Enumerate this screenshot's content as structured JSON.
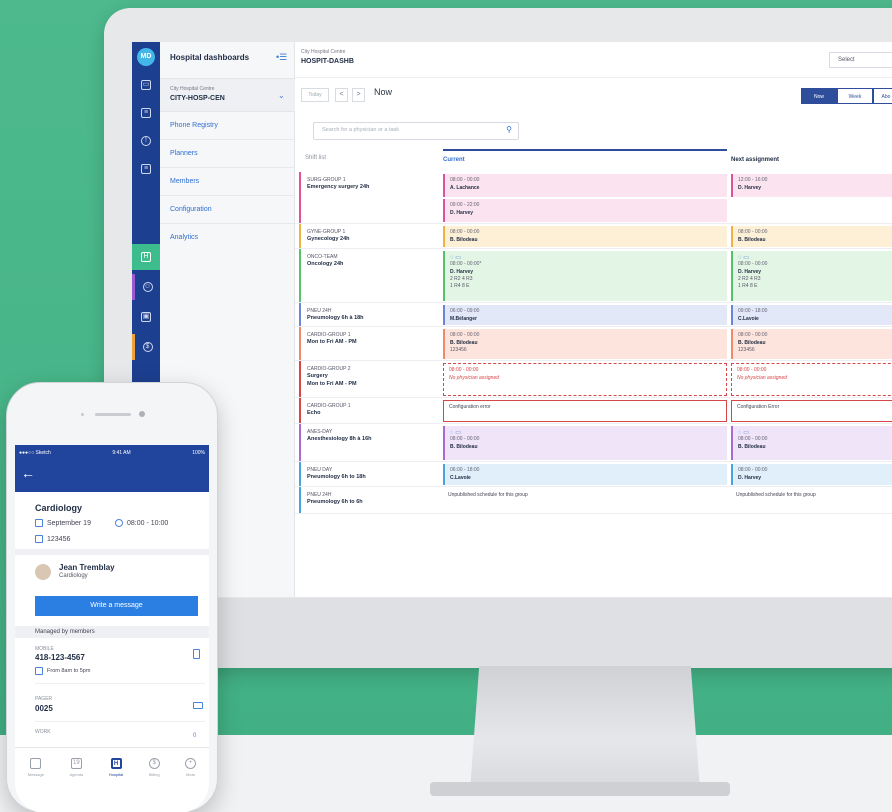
{
  "colors": {
    "brand": "#21459c",
    "accent": "#3dbd8e",
    "link": "#2f6fd0",
    "error": "#d84747",
    "background": "#4db98c"
  },
  "desktop": {
    "logo": "MD",
    "app_title": "Hospital dashboards",
    "org": {
      "name": "City Hospital Centre",
      "code": "CITY-HOSP-CEN"
    },
    "menu": [
      "Phone Registry",
      "Planners",
      "Members",
      "Configuration",
      "Analytics"
    ],
    "header": {
      "org_name": "City Hospital Centre",
      "dashboard_code": "HOSPIT-DASHB",
      "select_label": "Select"
    },
    "nav": {
      "today": "Today",
      "prev": "<",
      "next": ">",
      "title": "Now",
      "views": [
        "Now",
        "Week",
        "Abo"
      ]
    },
    "search": {
      "placeholder": "Search for a physician or a task"
    },
    "columns": {
      "shift": "Shift list",
      "current": "Current",
      "next": "Next assignment"
    },
    "rows": [
      {
        "group": "SURG-GROUP 1",
        "desc": "Emergency surgery 24h",
        "desc2": "",
        "color": "#e0529c",
        "current": [
          {
            "time": "08:00 - 00:00",
            "name": "A. Lachance",
            "extra": ""
          },
          {
            "time": "09:00 - 22:00",
            "name": "D. Harvey",
            "extra": ""
          }
        ],
        "next": {
          "time": "12:00 - 16:00",
          "name": "D. Harvey",
          "extra": ""
        }
      },
      {
        "group": "GYNE-GROUP 1",
        "desc": "Gynecology 24h",
        "desc2": "",
        "color": "#f2b23f",
        "current": [
          {
            "time": "08:00 - 00:00",
            "name": "B. Bilodeau",
            "extra": ""
          }
        ],
        "next": {
          "time": "08:00 - 00:00",
          "name": "B. Bilodeau",
          "extra": ""
        }
      },
      {
        "group": "ONCO-TEAM",
        "desc": "Oncology 24h",
        "desc2": "",
        "color": "#58c26a",
        "current": [
          {
            "time": "08:00 - 00:00*",
            "name": "D. Harvey",
            "extra": "2 R2  4 R3",
            "extra2": "1 R4  8 E"
          }
        ],
        "next": {
          "time": "08:00 - 00:00",
          "name": "D. Harvey",
          "extra": "2 R2  4 R3",
          "extra2": "1 R4  8 E"
        }
      },
      {
        "group": "PNEU 24H",
        "desc": "Pneumology 6h à 18h",
        "desc2": "",
        "color": "#6b86d6",
        "current": [
          {
            "time": "06:00 - 09:00",
            "name": "M.Bélanger",
            "extra": ""
          }
        ],
        "next": {
          "time": "09:00 - 18:00",
          "name": "C.Lavoie",
          "extra": ""
        }
      },
      {
        "group": "CARDIO-GROUP 1",
        "desc": "Mon to Fri  AM - PM",
        "desc2": "",
        "color": "#f08a6a",
        "current": [
          {
            "time": "08:00 - 00:00",
            "name": "B. Bilodeau",
            "extra": "123456"
          }
        ],
        "next": {
          "time": "08:00 - 00:00",
          "name": "B. Bilodeau",
          "extra": "123456"
        }
      },
      {
        "group": "CARDIO-GROUP 2",
        "desc": "Surgery",
        "desc2": "Mon to Fri  AM - PM",
        "color": "#d84747",
        "current": [
          {
            "time": "08:00 - 00:00",
            "name": "No physician assigned",
            "extra": ""
          }
        ],
        "next": {
          "time": "08:00 - 00:00",
          "name": "No physician assigned",
          "extra": ""
        }
      },
      {
        "group": "CARDIO-GROUP 1",
        "desc": "Echo",
        "desc2": "",
        "color": "#d84747",
        "current": [
          {
            "time": "",
            "name": "Configuration error",
            "extra": ""
          }
        ],
        "next": {
          "time": "",
          "name": "Configuration Error",
          "extra": ""
        }
      },
      {
        "group": "ANES-DAY",
        "desc": "Anesthesiology 8h à 16h",
        "desc2": "",
        "color": "#a86bd6",
        "current": [
          {
            "time": "08:00 - 00:00",
            "name": "B. Bilodeau",
            "extra": ""
          }
        ],
        "next": {
          "time": "08:00 - 00:00",
          "name": "B. Bilodeau",
          "extra": ""
        }
      },
      {
        "group": "PNEU DAY",
        "desc": "Pneumology 6h to 18h",
        "desc2": "",
        "color": "#4aa3df",
        "current": [
          {
            "time": "06:00 - 18:00",
            "name": "C.Lavoie",
            "extra": ""
          }
        ],
        "next": {
          "time": "08:00 - 00:00",
          "name": "D. Harvey",
          "extra": ""
        }
      },
      {
        "group": "PNEU 24H",
        "desc": "Pneumology 6h to 6h",
        "desc2": "",
        "color": "#4aa3df",
        "current": [
          {
            "time": "",
            "name": "Unpublished schedule for this group",
            "extra": ""
          }
        ],
        "next": {
          "time": "",
          "name": "Unpublished schedule for this group",
          "extra": ""
        }
      }
    ]
  },
  "mobile": {
    "status": {
      "carrier": "●●●○○ Sketch",
      "time": "9:41 AM",
      "battery": "100%"
    },
    "title": "Cardiology",
    "date": "September 19",
    "time_range": "08:00 - 10:00",
    "number": "123456",
    "contact": {
      "name": "Jean Tremblay",
      "specialty": "Cardiology"
    },
    "button": "Write a message",
    "managed_by": "Managed by members",
    "mobile_label": "MOBILE",
    "mobile_value": "418-123-4567",
    "mobile_hours": "From 8am to 5pm",
    "pager_label": "PAGER",
    "pager_value": "0025",
    "work_label": "WORK",
    "work_value": "0",
    "tabs": [
      {
        "label": "Message",
        "glyph": ""
      },
      {
        "label": "Agenda",
        "glyph": "19"
      },
      {
        "label": "Hospital",
        "glyph": "H"
      },
      {
        "label": "Billing",
        "glyph": "$"
      },
      {
        "label": "More",
        "glyph": "+"
      }
    ]
  }
}
